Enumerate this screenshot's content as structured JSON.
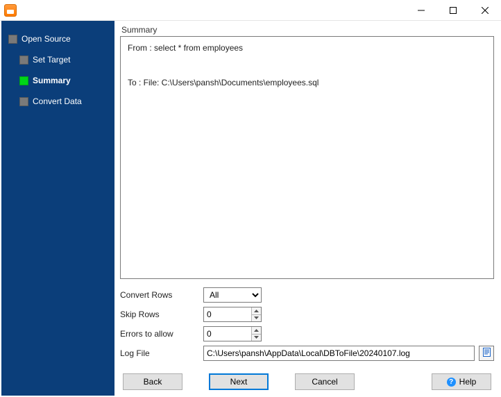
{
  "sidebar": {
    "items": [
      {
        "label": "Open Source",
        "indent": 0,
        "active": false
      },
      {
        "label": "Set Target",
        "indent": 1,
        "active": false
      },
      {
        "label": "Summary",
        "indent": 1,
        "active": true
      },
      {
        "label": "Convert Data",
        "indent": 1,
        "active": false
      }
    ]
  },
  "summary": {
    "title": "Summary",
    "body": "From : select * from employees\n\n\nTo : File: C:\\Users\\pansh\\Documents\\employees.sql"
  },
  "form": {
    "convert_rows_label": "Convert Rows",
    "convert_rows_value": "All",
    "skip_rows_label": "Skip Rows",
    "skip_rows_value": "0",
    "errors_label": "Errors to allow",
    "errors_value": "0",
    "log_label": "Log File",
    "log_value": "C:\\Users\\pansh\\AppData\\Local\\DBToFile\\20240107.log"
  },
  "buttons": {
    "back": "Back",
    "next": "Next",
    "cancel": "Cancel",
    "help": "Help"
  }
}
